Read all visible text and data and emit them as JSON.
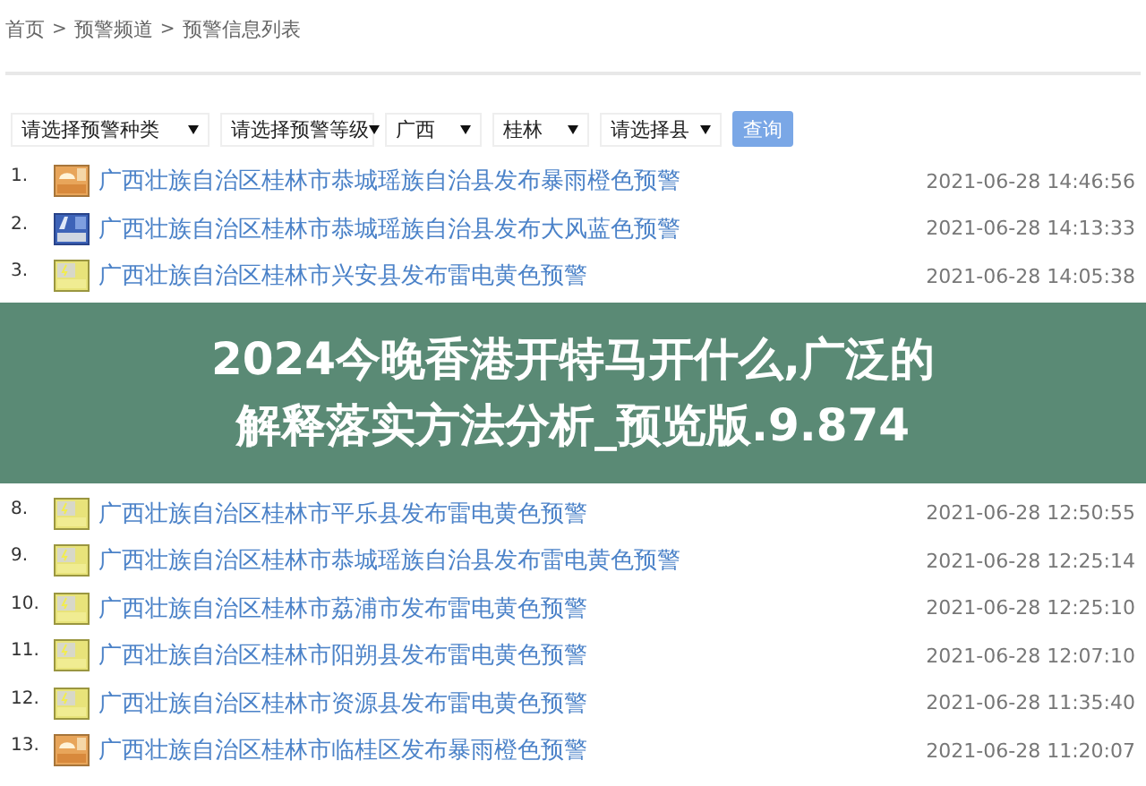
{
  "breadcrumb": [
    "首页",
    "预警频道",
    "预警信息列表"
  ],
  "breadcrumb_separator": ">",
  "filters": [
    {
      "value": "请选择预警种类"
    },
    {
      "value": "请选择预警等级"
    },
    {
      "value": "广西"
    },
    {
      "value": "桂林"
    },
    {
      "value": "请选择县"
    }
  ],
  "query_button": "查询",
  "alerts": [
    {
      "index": "1.",
      "kind": "rainstorm",
      "title": "广西壮族自治区桂林市恭城瑶族自治县发布暴雨橙色预警",
      "time": "2021-06-28 14:46:56"
    },
    {
      "index": "2.",
      "kind": "gale",
      "title": "广西壮族自治区桂林市恭城瑶族自治县发布大风蓝色预警",
      "time": "2021-06-28 14:13:33"
    },
    {
      "index": "3.",
      "kind": "thunder",
      "title": "广西壮族自治区桂林市兴安县发布雷电黄色预警",
      "time": "2021-06-28 14:05:38"
    }
  ],
  "banner": {
    "lines": [
      "2024今晚香港开特马开什么,广泛的",
      "解释落实方法分析_预览版.9.874"
    ]
  },
  "alerts_continued": [
    {
      "index": "8.",
      "kind": "thunder",
      "title": "广西壮族自治区桂林市平乐县发布雷电黄色预警",
      "time": "2021-06-28 12:50:55"
    },
    {
      "index": "9.",
      "kind": "thunder",
      "title": "广西壮族自治区桂林市恭城瑶族自治县发布雷电黄色预警",
      "time": "2021-06-28 12:25:14"
    },
    {
      "index": "10.",
      "kind": "thunder",
      "title": "广西壮族自治区桂林市荔浦市发布雷电黄色预警",
      "time": "2021-06-28 12:25:10"
    },
    {
      "index": "11.",
      "kind": "thunder",
      "title": "广西壮族自治区桂林市阳朔县发布雷电黄色预警",
      "time": "2021-06-28 12:07:10"
    },
    {
      "index": "12.",
      "kind": "thunder",
      "title": "广西壮族自治区桂林市资源县发布雷电黄色预警",
      "time": "2021-06-28 11:35:40"
    },
    {
      "index": "13.",
      "kind": "rainstorm",
      "title": "广西壮族自治区桂林市临桂区发布暴雨橙色预警",
      "time": "2021-06-28 11:20:07"
    }
  ]
}
